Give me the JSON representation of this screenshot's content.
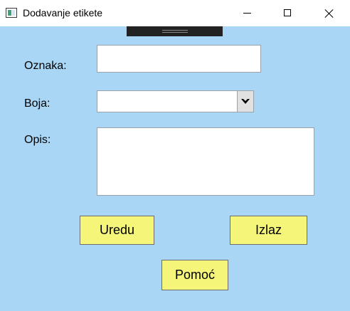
{
  "window": {
    "title": "Dodavanje etikete"
  },
  "form": {
    "oznaka_label": "Oznaka:",
    "oznaka_value": "",
    "boja_label": "Boja:",
    "boja_value": "",
    "opis_label": "Opis:",
    "opis_value": ""
  },
  "buttons": {
    "ok_label": "Uredu",
    "exit_label": "Izlaz",
    "help_label": "Pomoć"
  },
  "colors": {
    "background": "#a9d6f5",
    "button": "#f5f57a"
  },
  "icons": {
    "app": "app-window-icon",
    "minimize": "minimize-icon",
    "maximize": "maximize-icon",
    "close": "close-icon",
    "dropdown": "chevron-down-icon"
  }
}
